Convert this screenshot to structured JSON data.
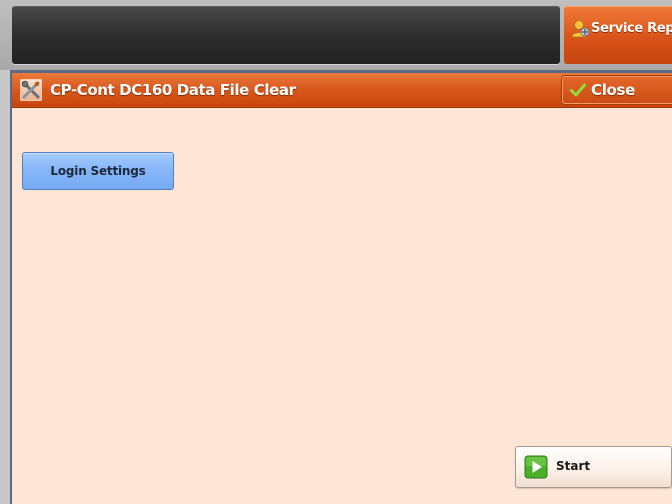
{
  "header": {
    "service_rep_label": "Service Rep."
  },
  "window": {
    "title": "CP-Cont DC160 Data File Clear",
    "close_label": "Close"
  },
  "main": {
    "login_settings_label": "Login Settings",
    "start_label": "Start"
  },
  "icons": {
    "service_rep": "service-rep-person-icon",
    "title": "tools-icon",
    "close": "check-icon",
    "start": "play-icon"
  },
  "colors": {
    "accent_orange": "#d9561b",
    "content_bg": "#fde6d6",
    "login_button": "#86b5f7",
    "status_panel": "#2c2c2c"
  }
}
